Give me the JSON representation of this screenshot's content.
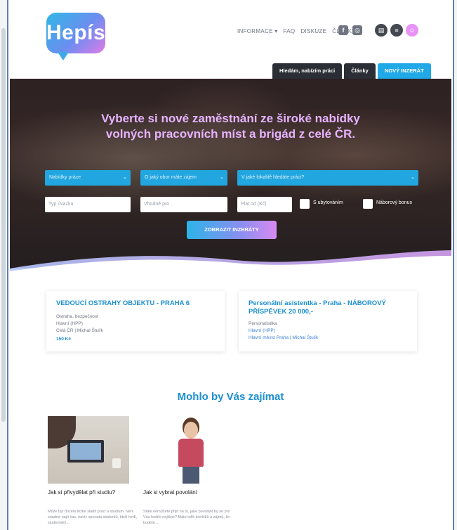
{
  "header": {
    "logo_text": "Hepís",
    "nav": [
      "INFORMACE ▾",
      "FAQ",
      "DISKUZE",
      "ČLÁNKY"
    ],
    "social_icons": [
      "facebook-icon",
      "instagram-icon"
    ],
    "circle_icons": [
      "message-icon",
      "menu-icon",
      "user-icon"
    ],
    "tabs": {
      "search_jobs": "Hledám, nabízím práci",
      "articles": "Články",
      "new_ad": "NOVÝ INZERÁT"
    }
  },
  "hero": {
    "title_line1": "Vyberte si nové zaměstnání ze široké nabídky",
    "title_line2": "volných pracovních míst a brigád z celé ČR.",
    "select_offers": "Nabídky práce",
    "select_field": "O jaký obor máte zájem",
    "select_where": "V jaké lokalitě hledáte práci?",
    "input_type": "Typ úvazku",
    "input_for": "Vhodné pro",
    "input_salary": "Plat od (Kč)",
    "checkbox_accommodation": "S ubytováním",
    "checkbox_bonus": "Náborový bonus",
    "show_button": "ZOBRAZIT INZERÁTY"
  },
  "jobs": [
    {
      "title": "VEDOUCÍ OSTRAHY OBJEKTU - PRAHA 6",
      "line1": "Ostraha, bezpečnost",
      "line2": "Hlavní (HPP)",
      "line3": "Celá ČR | Michal Štulík",
      "price": "150 Kč"
    },
    {
      "title": "Personální asistentka - Praha - NÁBOROVÝ PŘÍSPĚVEK 20 000,-",
      "line1": "Personalistika",
      "line2": "Hlavní (HPP)",
      "line3": "Hlavní město Praha  |  Michal Štulík",
      "price": ""
    }
  ],
  "section": {
    "title": "Mohlo by Vás zajímat"
  },
  "articles": [
    {
      "title": "Jak si přivydělat při studiu?",
      "text": "Může být docela těžké sladit práci a studium. Není snadné najít čas, navíc spousta studentů, kteří tvrdí, studentský..."
    },
    {
      "title": "Jak si vybrat povolání",
      "text": "Stále nemůžete přijít na to, jaké povolání by se pro Vás hodilo nejlépe? Máte tolik koníčků a zájmů, že budete..."
    }
  ],
  "colors": {
    "accent_blue": "#1b8fd0",
    "tab_blue": "#21a8e6",
    "hero_title": "#e7b3ff"
  }
}
